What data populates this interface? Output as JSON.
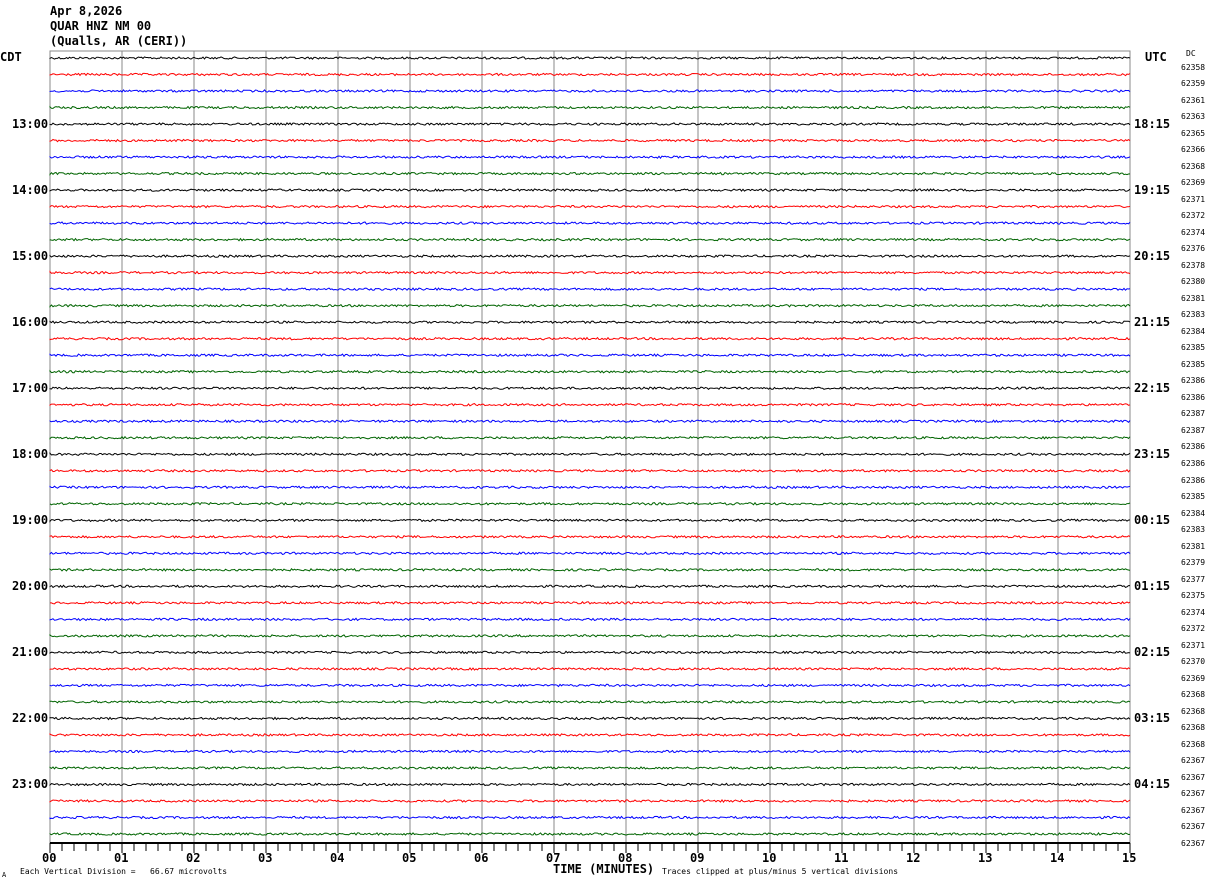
{
  "header": {
    "date": "Apr 8,2026",
    "station": "QUAR HNZ NM 00",
    "location": "(Qualls, AR (CERI))"
  },
  "left_tz": "CDT",
  "right_tz": "UTC",
  "dc_header": "DC",
  "footer": {
    "scale": "Each Vertical Division =   66.67 microvolts",
    "clip": "Traces clipped at plus/minus 5 vertical divisions",
    "mark": "A"
  },
  "chart_data": {
    "type": "line",
    "title": "QUAR HNZ NM 00",
    "xlabel": "TIME (MINUTES)",
    "xlim": [
      0,
      15
    ],
    "x_ticks": [
      "00",
      "01",
      "02",
      "03",
      "04",
      "05",
      "06",
      "07",
      "08",
      "09",
      "10",
      "11",
      "12",
      "13",
      "14",
      "15"
    ],
    "left_time_labels": [
      "13:00",
      "14:00",
      "15:00",
      "16:00",
      "17:00",
      "18:00",
      "19:00",
      "20:00",
      "21:00",
      "22:00",
      "23:00"
    ],
    "right_time_labels": [
      "18:15",
      "19:15",
      "20:15",
      "21:15",
      "22:15",
      "23:15",
      "00:15",
      "01:15",
      "02:15",
      "03:15",
      "04:15"
    ],
    "trace_colors": [
      "#000000",
      "#ff0000",
      "#0000ff",
      "#006400"
    ],
    "dc_offsets": [
      62358,
      62359,
      62361,
      62363,
      62365,
      62366,
      62368,
      62369,
      62371,
      62372,
      62374,
      62376,
      62378,
      62380,
      62381,
      62383,
      62384,
      62385,
      62385,
      62386,
      62386,
      62387,
      62387,
      62386,
      62386,
      62386,
      62385,
      62384,
      62383,
      62381,
      62379,
      62377,
      62375,
      62374,
      62372,
      62371,
      62370,
      62369,
      62368,
      62368,
      62368,
      62368,
      62367,
      62367,
      62367,
      62367,
      62367,
      62367
    ],
    "grid": true
  }
}
